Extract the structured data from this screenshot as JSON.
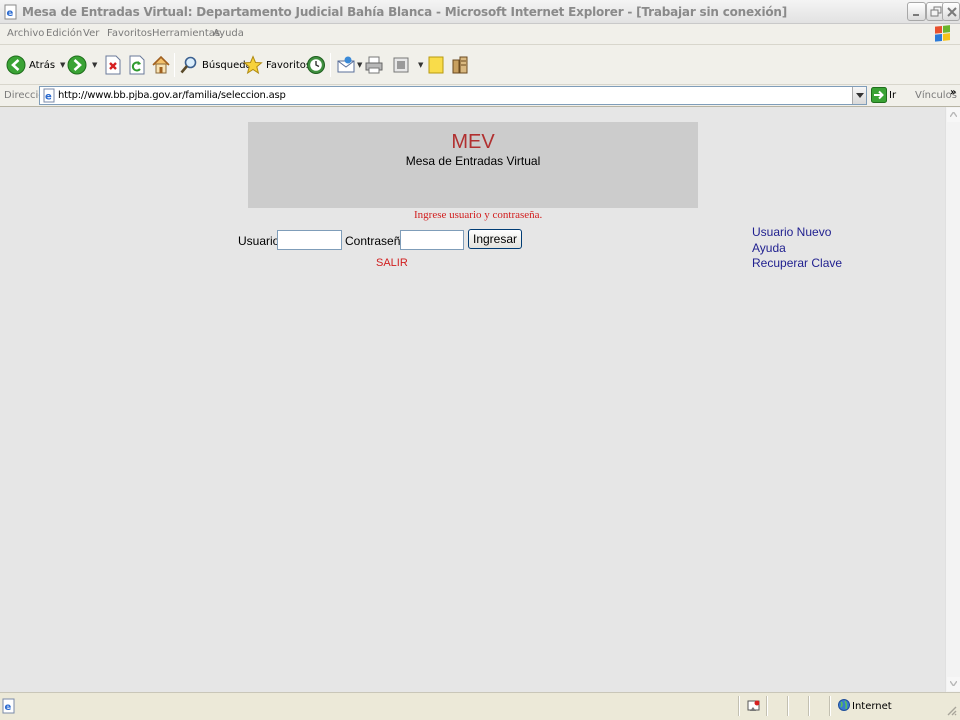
{
  "window": {
    "title": "Mesa de Entradas Virtual: Departamento Judicial Bahía Blanca - Microsoft Internet Explorer - [Trabajar sin conexión]"
  },
  "menu": {
    "items": [
      "Archivo",
      "Edición",
      "Ver",
      "Favoritos",
      "Herramientas",
      "Ayuda"
    ]
  },
  "toolbar": {
    "back_label": "Atrás",
    "search_label": "Búsqueda",
    "favorites_label": "Favoritos"
  },
  "address": {
    "label": "Dirección",
    "url": "http://www.bb.pjba.gov.ar/familia/seleccion.asp",
    "go_label": "Ir",
    "links_label": "Vínculos",
    "links_chevron": "»"
  },
  "page": {
    "banner_title": "MEV",
    "banner_subtitle": "Mesa de Entradas Virtual",
    "prompt": "Ingrese usuario y contraseña.",
    "user_label": "Usuario:",
    "user_value": "",
    "password_label": "Contraseña:",
    "password_value": "",
    "submit_label": "Ingresar",
    "exit_label": "SALIR",
    "side_links": [
      "Usuario Nuevo",
      "Ayuda",
      "Recuperar Clave"
    ]
  },
  "status": {
    "zone": "Internet"
  },
  "colors": {
    "banner_title": "#b13030",
    "banner_bg": "#cccccc",
    "error_text": "#d11e1e",
    "link": "#1f1f8f",
    "content_bg": "#e6e6e6"
  }
}
